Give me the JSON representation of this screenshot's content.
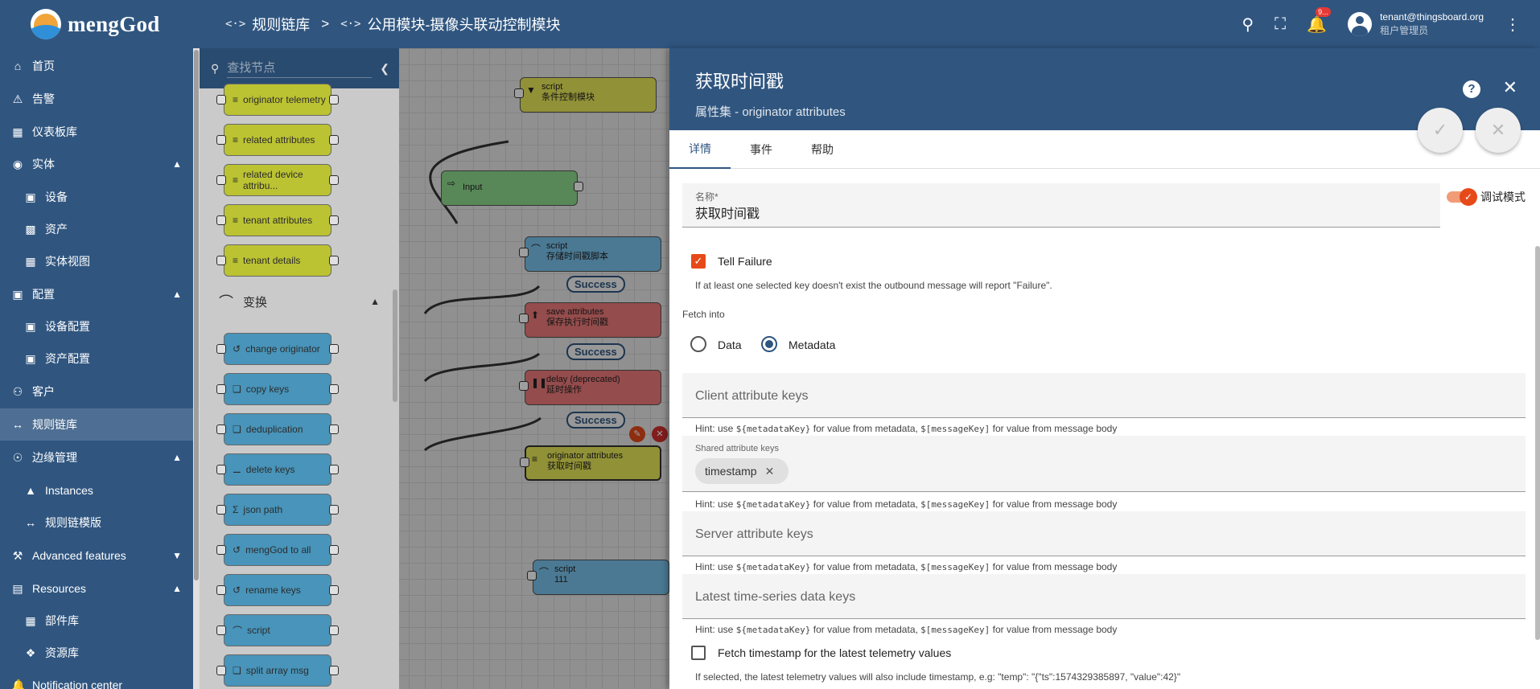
{
  "app": {
    "name": "mengGod"
  },
  "breadcrumb": [
    {
      "icon": "<·>",
      "label": "规则链库"
    },
    {
      "icon": "<·>",
      "label": "公用模块-摄像头联动控制模块"
    }
  ],
  "breadcrumb_separator": ">",
  "header": {
    "notification_count": "9...",
    "user_email": "tenant@thingsboard.org",
    "user_role": "租户管理员"
  },
  "sidebar": {
    "items": [
      {
        "label": "首页",
        "icon": "home-icon"
      },
      {
        "label": "告警",
        "icon": "warning-icon"
      },
      {
        "label": "仪表板库",
        "icon": "dashboard-icon"
      },
      {
        "label": "实体",
        "icon": "entity-icon"
      },
      {
        "label": "设备",
        "icon": "device-icon"
      },
      {
        "label": "资产",
        "icon": "asset-icon"
      },
      {
        "label": "实体视图",
        "icon": "entity-view-icon"
      },
      {
        "label": "配置",
        "icon": "profile-icon"
      },
      {
        "label": "设备配置",
        "icon": "device-profile-icon"
      },
      {
        "label": "资产配置",
        "icon": "asset-profile-icon"
      },
      {
        "label": "客户",
        "icon": "customers-icon"
      },
      {
        "label": "规则链库",
        "icon": "rule-chain-icon"
      },
      {
        "label": "边缘管理",
        "icon": "edge-icon"
      },
      {
        "label": "Instances",
        "icon": "instances-icon"
      },
      {
        "label": "规则链模版",
        "icon": "rule-chain-template-icon"
      },
      {
        "label": "Advanced features",
        "icon": "advanced-icon"
      },
      {
        "label": "Resources",
        "icon": "folder-icon"
      },
      {
        "label": "部件库",
        "icon": "widgets-icon"
      },
      {
        "label": "资源库",
        "icon": "resources-icon"
      },
      {
        "label": "Notification center",
        "icon": "notification-center-icon"
      }
    ]
  },
  "palette": {
    "search_placeholder": "查找节点",
    "enrichment_nodes": [
      "originator telemetry",
      "related attributes",
      "related device attribu...",
      "tenant attributes",
      "tenant details"
    ],
    "transform_section": "变换",
    "transform_nodes": [
      "change originator",
      "copy keys",
      "deduplication",
      "delete keys",
      "json path",
      "mengGod to all",
      "rename keys",
      "script",
      "split array msg"
    ]
  },
  "chain": {
    "nodes": [
      {
        "type": "script",
        "name": "条件控制模块"
      },
      {
        "type": "",
        "name": "Input"
      },
      {
        "type": "script",
        "name": "存储时间戳脚本"
      },
      {
        "type": "save attributes",
        "name": "保存执行时间戳"
      },
      {
        "type": "delay (deprecated)",
        "name": "延时操作"
      },
      {
        "type": "originator attributes",
        "name": "获取时间戳"
      },
      {
        "type": "script",
        "name": "111"
      }
    ],
    "links": [
      "Success",
      "Success",
      "Success"
    ]
  },
  "details": {
    "title": "获取时间戳",
    "subtitle": "属性集 - originator attributes",
    "tabs": [
      "详情",
      "事件",
      "帮助"
    ],
    "name_label": "名称*",
    "name_value": "获取时间戳",
    "debug_label": "调试模式",
    "tell_failure_label": "Tell Failure",
    "tell_failure_hint": "If at least one selected key doesn't exist the outbound message will report \"Failure\".",
    "fetch_into_label": "Fetch into",
    "fetch_options": [
      "Data",
      "Metadata"
    ],
    "client_keys_placeholder": "Client attribute keys",
    "hint_prefix": "Hint: use",
    "hint_metadata": "${metadataKey}",
    "hint_middle": "for value from metadata,",
    "hint_message": "$[messageKey]",
    "hint_suffix": "for value from message body",
    "shared_keys_label": "Shared attribute keys",
    "shared_keys": [
      "timestamp"
    ],
    "server_keys_placeholder": "Server attribute keys",
    "latest_ts_placeholder": "Latest time-series data keys",
    "fetch_ts_label": "Fetch timestamp for the latest telemetry values",
    "fetch_ts_hint": "If selected, the latest telemetry values will also include timestamp, e.g: \"temp\": \"{\"ts\":1574329385897, \"value\":42}\""
  }
}
